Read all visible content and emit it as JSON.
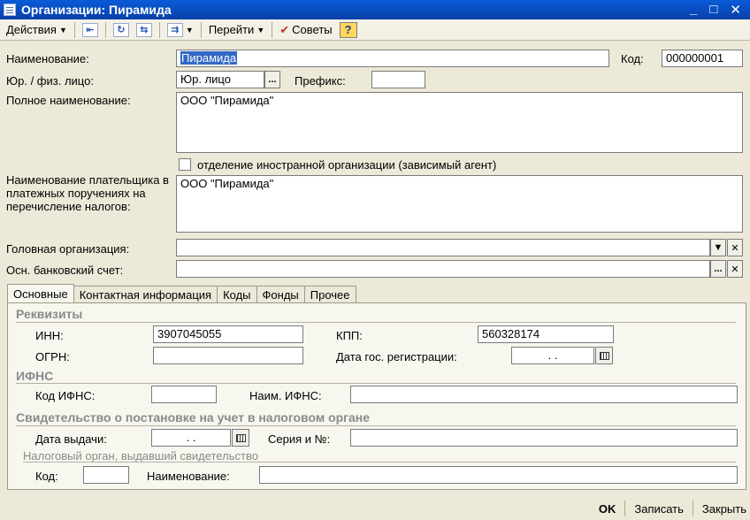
{
  "window": {
    "title": "Организации: Пирамида",
    "min": "_",
    "max": "□",
    "close": "✕"
  },
  "toolbar": {
    "actions": "Действия",
    "goto": "Перейти",
    "tips": "Советы",
    "help": "?"
  },
  "form": {
    "name_label": "Наименование:",
    "name_value": "Пирамида",
    "code_label": "Код:",
    "code_value": "000000001",
    "entity_label": "Юр. / физ. лицо:",
    "entity_value": "Юр. лицо",
    "prefix_label": "Префикс:",
    "prefix_value": "",
    "fullname_label": "Полное наименование:",
    "fullname_value": "ООО \"Пирамида\"",
    "foreign_label": "отделение иностранной организации (зависимый агент)",
    "payer_label": "Наименование плательщика в платежных поручениях на перечисление налогов:",
    "payer_value": "ООО \"Пирамида\"",
    "parent_label": "Головная организация:",
    "parent_value": "",
    "bank_label": "Осн. банковский счет:",
    "bank_value": ""
  },
  "tabs": [
    "Основные",
    "Контактная информация",
    "Коды",
    "Фонды",
    "Прочее"
  ],
  "main_tab": {
    "requisites_title": "Реквизиты",
    "inn_label": "ИНН:",
    "inn_value": "3907045055",
    "kpp_label": "КПП:",
    "kpp_value": "560328174",
    "ogrn_label": "ОГРН:",
    "ogrn_value": "",
    "regdate_label": "Дата гос. регистрации:",
    "regdate_value": " .  .",
    "ifns_title": "ИФНС",
    "ifns_code_label": "Код ИФНС:",
    "ifns_code_value": "",
    "ifns_name_label": "Наим. ИФНС:",
    "ifns_name_value": "",
    "cert_title": "Свидетельство о постановке на учет в налоговом органе",
    "issue_date_label": "Дата выдачи:",
    "issue_date_value": " .  .",
    "series_label": "Серия и №:",
    "series_value": "",
    "authority_title": "Налоговый орган, выдавший свидетельство",
    "auth_code_label": "Код:",
    "auth_code_value": "",
    "auth_name_label": "Наименование:",
    "auth_name_value": ""
  },
  "bottom": {
    "ok": "OK",
    "save": "Записать",
    "close": "Закрыть"
  }
}
